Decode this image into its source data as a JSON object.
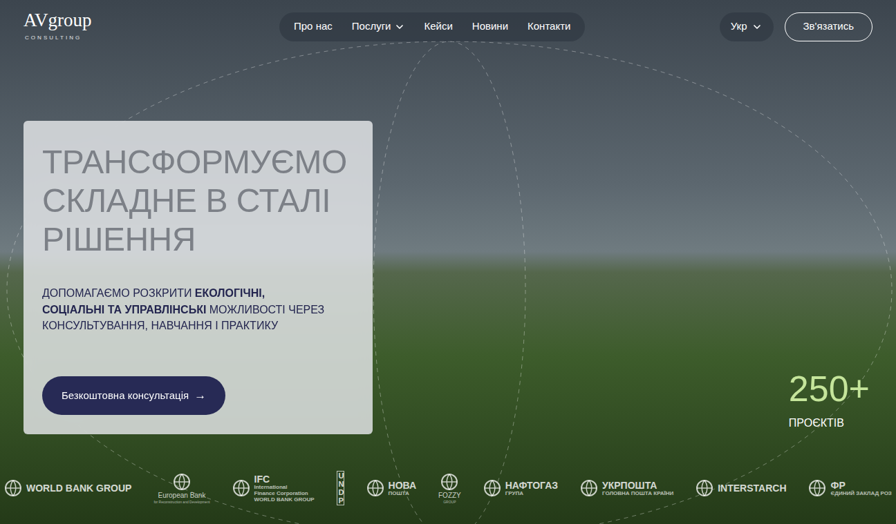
{
  "header": {
    "logo": {
      "title": "AVgroup",
      "subtitle": "CONSULTING"
    },
    "nav": [
      {
        "label": "Про нас",
        "dropdown": false
      },
      {
        "label": "Послуги",
        "dropdown": true
      },
      {
        "label": "Кейси",
        "dropdown": false
      },
      {
        "label": "Новини",
        "dropdown": false
      },
      {
        "label": "Контакти",
        "dropdown": false
      }
    ],
    "language": {
      "label": "Укр",
      "dropdown": true
    },
    "contact_button": "Зв'язатись"
  },
  "hero": {
    "heading": [
      "ТРАНСФОРМУЄМО",
      "СКЛАДНЕ В СТАЛІ",
      "РІШЕННЯ"
    ],
    "subtitle": [
      {
        "text": "ДОПОМАГАЄМО РОЗКРИТИ ",
        "bold": false
      },
      {
        "text": "ЕКОЛОГІЧНІ, СОЦІАЛЬНІ ТА УПРАВЛІНСЬКІ",
        "bold": true
      },
      {
        "text": " МОЖЛИВОСТІ ЧЕРЕЗ КОНСУЛЬТУВАННЯ, НАВЧАННЯ І ПРАКТИКУ",
        "bold": false
      }
    ],
    "cta": {
      "label": "Безкоштовна консультація",
      "arrow": "→"
    }
  },
  "stats": {
    "value": "250+",
    "label": "ПРОЄКТІВ"
  },
  "logos": [
    {
      "kind": "inline",
      "lines": [
        "WORLD BANK GROUP"
      ]
    },
    {
      "kind": "stacked",
      "lines": [
        "European Bank",
        "for Reconstruction and Development"
      ]
    },
    {
      "kind": "inline",
      "lines": [
        "IFC",
        "International",
        "Finance Corporation",
        "WORLD BANK GROUP"
      ]
    },
    {
      "kind": "vertical",
      "lines": [
        "UNDP"
      ]
    },
    {
      "kind": "inline",
      "lines": [
        "НОВА",
        "ПОШТА"
      ]
    },
    {
      "kind": "stacked",
      "lines": [
        "FOZZY",
        "GROUP"
      ]
    },
    {
      "kind": "inline",
      "lines": [
        "НАФТОГАЗ",
        "ГРУПА"
      ]
    },
    {
      "kind": "inline",
      "lines": [
        "УКРПОШТА",
        "ГОЛОВНА ПОШТА КРАЇНИ"
      ]
    },
    {
      "kind": "inline",
      "lines": [
        "INTERSTARCH"
      ]
    },
    {
      "kind": "inline",
      "lines": [
        "ФР",
        "ЄДИНИЙ ЗАКЛАД РОЗ"
      ]
    }
  ]
}
